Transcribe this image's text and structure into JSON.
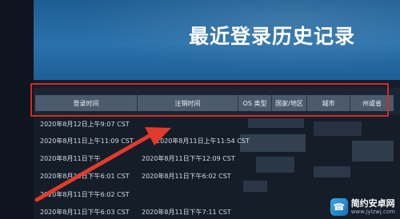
{
  "page": {
    "title": "最近登录历史记录"
  },
  "table": {
    "headers": {
      "login_time": "登录时间",
      "logout_time": "注销时间",
      "os_type": "OS 类型",
      "country": "国家/地区",
      "city": "城市",
      "state": "州或省"
    },
    "rows": [
      {
        "login": "2020年8月12日上午9:07 CST",
        "logout": ""
      },
      {
        "login": "2020年8月11日上午11:09 CST",
        "logout": "2020年8月11日上午11:54 CST"
      },
      {
        "login": "2020年8月11日下午",
        "logout": "2020年8月11日下午12:09 CST"
      },
      {
        "login": "2020年8月11日下午",
        "logout": "2020年8月11日下午"
      },
      {
        "login": "2020年8月11日下午6:01 CST",
        "logout": "2020年8月11日下午6:02 CST"
      },
      {
        "login": "2020年8月11日下午6:02 CST",
        "logout": ""
      },
      {
        "login": "2020年8月11日下午6:03 CST",
        "logout": "2020年8月11日下午7:11 CST"
      }
    ]
  },
  "annotation": {
    "outline_color": "#cf2a2a",
    "arrow_color": "#e23a2c"
  },
  "watermark": {
    "name": "简约安卓网",
    "url": "www.jylzwj.com",
    "icon": "phone-icon"
  }
}
